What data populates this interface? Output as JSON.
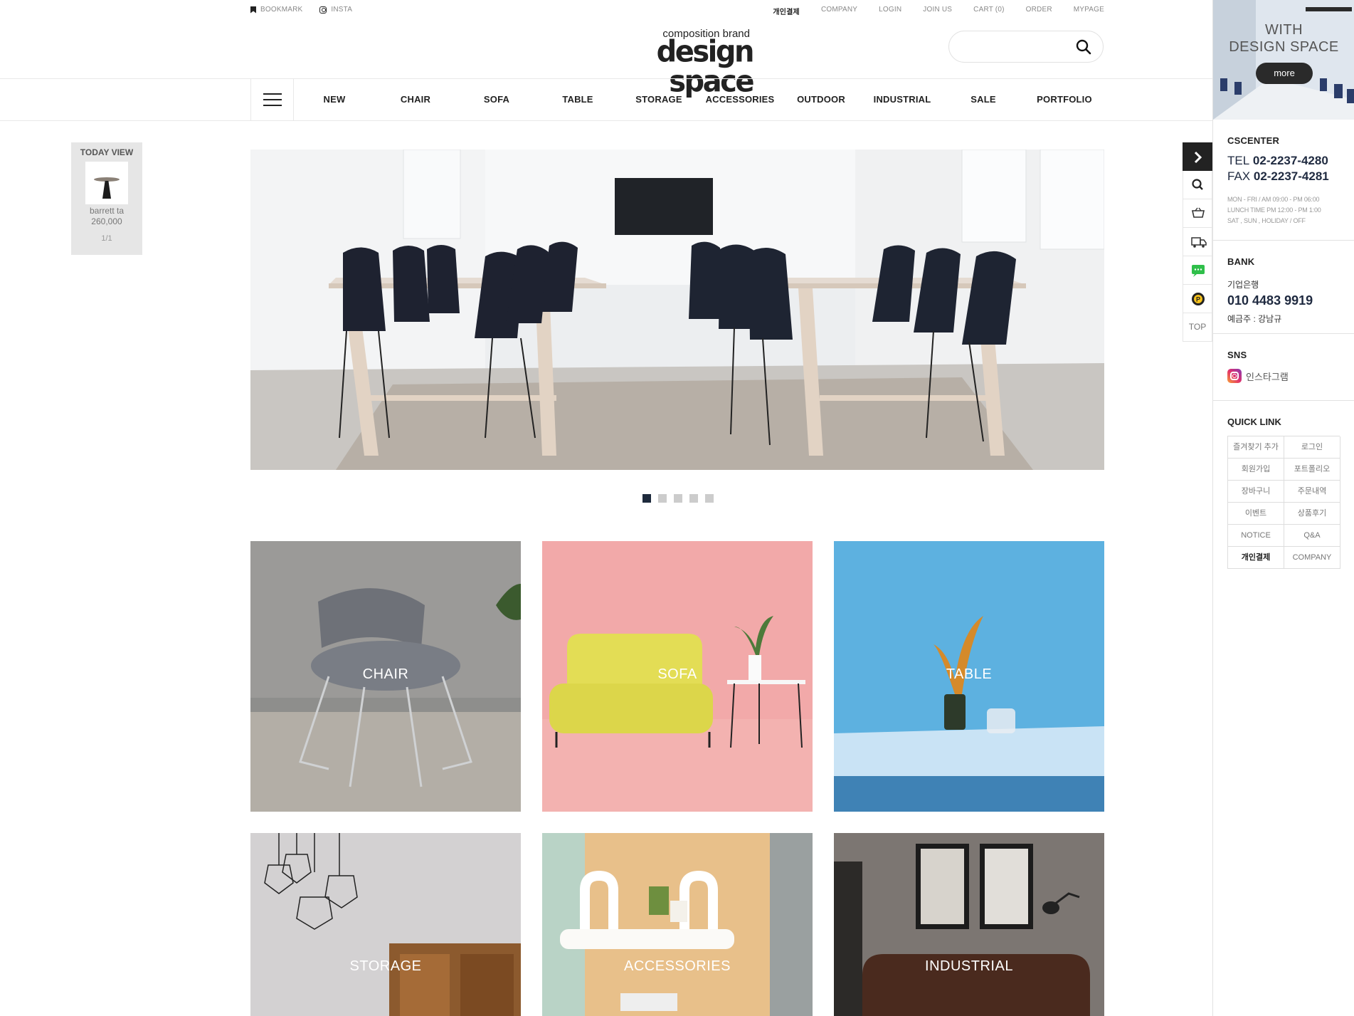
{
  "topbar": {
    "left": [
      "BOOKMARK",
      "INSTA"
    ],
    "right": [
      "개인결제",
      "COMPANY",
      "LOGIN",
      "JOIN US",
      "CART (0)",
      "ORDER",
      "MYPAGE"
    ]
  },
  "logo": {
    "sub": "composition brand",
    "main": "design space"
  },
  "search": {
    "placeholder": "",
    "value": ""
  },
  "nav": [
    "NEW",
    "CHAIR",
    "SOFA",
    "TABLE",
    "STORAGE",
    "ACCESSORIES",
    "OUTDOOR",
    "INDUSTRIAL",
    "SALE",
    "PORTFOLIO"
  ],
  "today_view": {
    "title": "TODAY VIEW",
    "item_name": "barrett ta",
    "item_price": "260,000",
    "page": "1/1"
  },
  "hero": {
    "slides": 5,
    "active_slide": 1
  },
  "categories": [
    "CHAIR",
    "SOFA",
    "TABLE",
    "STORAGE",
    "ACCESSORIES",
    "INDUSTRIAL"
  ],
  "quickbar": {
    "top_label": "TOP",
    "icons": [
      "arrow-right-icon",
      "search-icon",
      "cart-icon",
      "delivery-truck-icon",
      "chat-icon",
      "point-icon"
    ]
  },
  "banner": {
    "line1": "WITH",
    "line2": "DESIGN SPACE",
    "button": "more"
  },
  "cscenter": {
    "title": "CSCENTER",
    "tel_label": "TEL",
    "tel": "02-2237-4280",
    "fax_label": "FAX",
    "fax": "02-2237-4281",
    "hours1": "MON - FRI / AM 09:00 - PM 06:00",
    "hours2": "LUNCH TIME PM 12:00 - PM 1:00",
    "hours3": "SAT , SUN , HOLIDAY / OFF"
  },
  "bank": {
    "title": "BANK",
    "name": "기업은행",
    "account": "010 4483 9919",
    "holder": "예금주 : 강남규"
  },
  "sns": {
    "title": "SNS",
    "instagram": "인스타그램"
  },
  "quick_link": {
    "title": "QUICK LINK",
    "items": [
      "즐겨찾기 추가",
      "로그인",
      "회원가입",
      "포트폴리오",
      "장바구니",
      "주문내역",
      "이벤트",
      "상품후기",
      "NOTICE",
      "Q&A",
      "개인결제",
      "COMPANY"
    ]
  },
  "colors": {
    "accent": "#1f2a40",
    "dot_active": "#1e2a3c",
    "sofa_bg": "#f2a9a9",
    "table_bg": "#5db1e0"
  }
}
